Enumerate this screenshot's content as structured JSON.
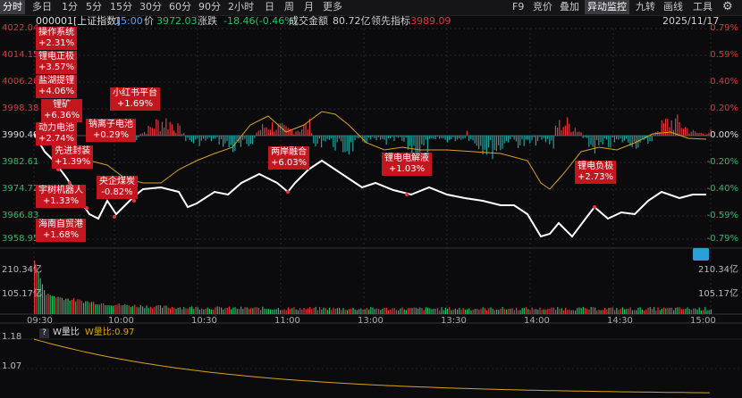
{
  "toolbar": {
    "tabs": [
      "分时",
      "多日",
      "1分",
      "5分",
      "15分",
      "30分",
      "60分",
      "90分",
      "2小时",
      "日",
      "周",
      "月",
      "更多"
    ],
    "active_tab": "分时",
    "right_tabs": [
      "F9",
      "竞价",
      "叠加",
      "异动监控",
      "九转",
      "画线",
      "工具"
    ],
    "active_right_tab": "异动监控",
    "settings_icon": "gear-icon"
  },
  "info": {
    "code_name": "000001[上证指数]",
    "time": "15:00",
    "price_label": "价",
    "price": "3972.03",
    "change_label": "涨跌",
    "change": "-18.46(-0.46%)",
    "amount_label": "成交金额",
    "amount": "80.72亿",
    "lead_label": "领先指标",
    "lead": "3989.09",
    "date": "2025/11/17"
  },
  "y_left": [
    "4022.04",
    "4014.15",
    "4006.26",
    "3998.38",
    "3990.49",
    "3982.61",
    "3974.72",
    "3966.83",
    "3958.95"
  ],
  "y_right": [
    "0.79%",
    "0.59%",
    "0.40%",
    "0.20%",
    "0.00%",
    "-0.20%",
    "-0.40%",
    "-0.59%",
    "-0.79%"
  ],
  "vol_left": [
    "210.34亿",
    "105.17亿"
  ],
  "x_labels": [
    "09:30",
    "10:00",
    "10:30",
    "11:00",
    "13:00",
    "13:30",
    "14:00",
    "14:30",
    "15:00"
  ],
  "tags": [
    {
      "name": "操作系统",
      "pct": "+2.31%"
    },
    {
      "name": "锂电正极",
      "pct": "+3.57%"
    },
    {
      "name": "盐湖提锂",
      "pct": "+4.06%"
    },
    {
      "name": "锂矿",
      "pct": "+6.36%"
    },
    {
      "name": "动力电池",
      "pct": "+2.74%"
    },
    {
      "name": "先进封装",
      "pct": "+1.39%"
    },
    {
      "name": "宇树机器人",
      "pct": "+1.33%"
    },
    {
      "name": "海南自贸港",
      "pct": "+1.68%"
    },
    {
      "name": "钠离子电池",
      "pct": "+0.29%"
    },
    {
      "name": "小红书平台",
      "pct": "+1.69%"
    },
    {
      "name": "央企煤炭",
      "pct": "-0.82%"
    },
    {
      "name": "两岸融合",
      "pct": "+6.03%"
    },
    {
      "name": "锂电电解液",
      "pct": "+1.03%"
    },
    {
      "name": "锂电负极",
      "pct": "+2.73%"
    }
  ],
  "bottom": {
    "help": "?",
    "indicator": "W量比",
    "value_text": "W量比:0.97",
    "y_labels": [
      "1.18",
      "1.07"
    ]
  },
  "colors": {
    "up": "#e8323c",
    "down": "#1fc16b",
    "price_line": "#ffffff",
    "avg_line": "#d9a21b",
    "bg": "#0b0b0d"
  }
}
